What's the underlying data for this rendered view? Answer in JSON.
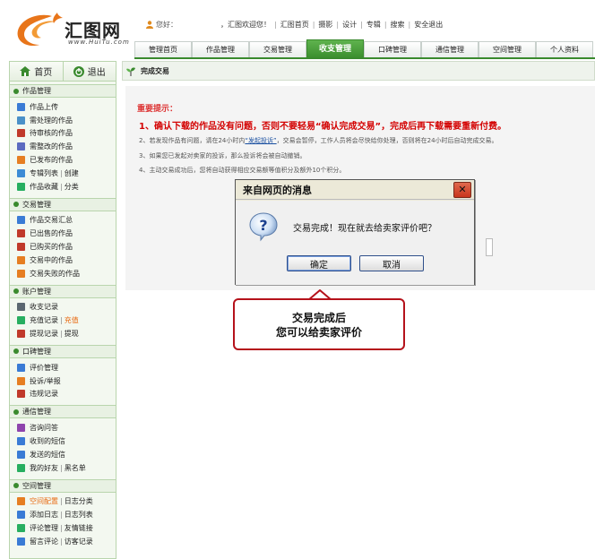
{
  "logo": {
    "text": "汇图网",
    "sub": "www.HuiTu.com"
  },
  "topbar": {
    "greeting": "您好：",
    "welcome": "，汇图欢迎您！",
    "links": [
      "汇图首页",
      "摄影",
      "设计",
      "专辑",
      "搜索",
      "安全退出"
    ]
  },
  "nav": {
    "tabs": [
      "管理首页",
      "作品管理",
      "交易管理",
      "收支管理",
      "口碑管理",
      "通信管理",
      "空间管理",
      "个人资料"
    ],
    "active": "收支管理"
  },
  "sidebar": {
    "home": "首页",
    "logout": "退出",
    "groups": [
      {
        "title": "作品管理",
        "items": [
          {
            "label": "作品上传",
            "icon": "upload-icon",
            "color": "#3a7bd5"
          },
          {
            "label": "需处理的作品",
            "icon": "pending-icon",
            "color": "#4a90c8"
          },
          {
            "label": "待审核的作品",
            "icon": "review-icon",
            "color": "#c0392b"
          },
          {
            "label": "需整改的作品",
            "icon": "fix-icon",
            "color": "#5c6bc0"
          },
          {
            "label": "已发布的作品",
            "icon": "published-icon",
            "color": "#e67e22"
          },
          {
            "label": "专辑列表",
            "label2": "创建",
            "icon": "album-icon",
            "color": "#3d8bd5"
          },
          {
            "label": "作品收藏",
            "label2": "分类",
            "icon": "favorite-icon",
            "color": "#27ae60"
          }
        ]
      },
      {
        "title": "交易管理",
        "items": [
          {
            "label": "作品交易汇总",
            "icon": "summary-icon",
            "color": "#3a7bd5"
          },
          {
            "label": "已出售的作品",
            "icon": "sold-icon",
            "color": "#c0392b"
          },
          {
            "label": "已购买的作品",
            "icon": "bought-icon",
            "color": "#c0392b"
          },
          {
            "label": "交易中的作品",
            "icon": "trading-icon",
            "color": "#e67e22"
          },
          {
            "label": "交易失败的作品",
            "icon": "failed-icon",
            "color": "#e67e22"
          }
        ]
      },
      {
        "title": "账户管理",
        "items": [
          {
            "label": "收支记录",
            "icon": "record-icon",
            "color": "#5b6770"
          },
          {
            "label": "充值记录",
            "label2": "充值",
            "icon": "recharge-icon",
            "color": "#27ae60",
            "orange2": true
          },
          {
            "label": "提现记录",
            "label2": "提现",
            "icon": "withdraw-icon",
            "color": "#c0392b"
          }
        ]
      },
      {
        "title": "口碑管理",
        "items": [
          {
            "label": "评价管理",
            "icon": "pen-icon",
            "color": "#3a7bd5"
          },
          {
            "label": "投诉/举报",
            "icon": "complaint-icon",
            "color": "#e67e22"
          },
          {
            "label": "违规记录",
            "icon": "violation-icon",
            "color": "#c0392b"
          }
        ]
      },
      {
        "title": "通信管理",
        "items": [
          {
            "label": "咨询问答",
            "icon": "qa-icon",
            "color": "#8e44ad"
          },
          {
            "label": "收到的短信",
            "icon": "inbox-icon",
            "color": "#3a7bd5"
          },
          {
            "label": "发送的短信",
            "icon": "outbox-icon",
            "color": "#3a7bd5"
          },
          {
            "label": "我的好友",
            "label2": "黑名单",
            "icon": "friends-icon",
            "color": "#27ae60"
          }
        ]
      },
      {
        "title": "空间管理",
        "items": [
          {
            "label": "空间配置",
            "label2": "日志分类",
            "icon": "space-icon",
            "color": "#e67e22",
            "orange1": true
          },
          {
            "label": "添加日志",
            "label2": "日志列表",
            "icon": "addlog-icon",
            "color": "#3a7bd5"
          },
          {
            "label": "评论管理",
            "label2": "友情链接",
            "icon": "comment-icon",
            "color": "#27ae60"
          },
          {
            "label": "留言评论",
            "label2": "访客记录",
            "icon": "message-icon",
            "color": "#3a7bd5"
          }
        ]
      }
    ]
  },
  "breadcrumb": "完成交易",
  "tips": {
    "title": "重要提示：",
    "items": [
      "1、确认下载的作品没有问题，否则不要轻易“确认完成交易”，完成后再下载需要重新付费。",
      "2、若发现作品有问题，请在24小时内",
      "3、如果您已发起对卖家的投诉，那么投诉将会被自动撤销。",
      "4、主动交易成功后，您将自动获得相应交易额等值积分及额外10个积分。"
    ],
    "item2_link": "“发起投诉”",
    "item2_rest": "，交易会暂停，工作人员将会尽快给你处理，否则将在24小时后自动完成交易。"
  },
  "dialog": {
    "title": "来自网页的消息",
    "message": "交易完成！现在就去给卖家评价吧？",
    "ok": "确定",
    "cancel": "取消"
  },
  "callout": {
    "line1": "交易完成后",
    "line2": "您可以给卖家评价"
  }
}
